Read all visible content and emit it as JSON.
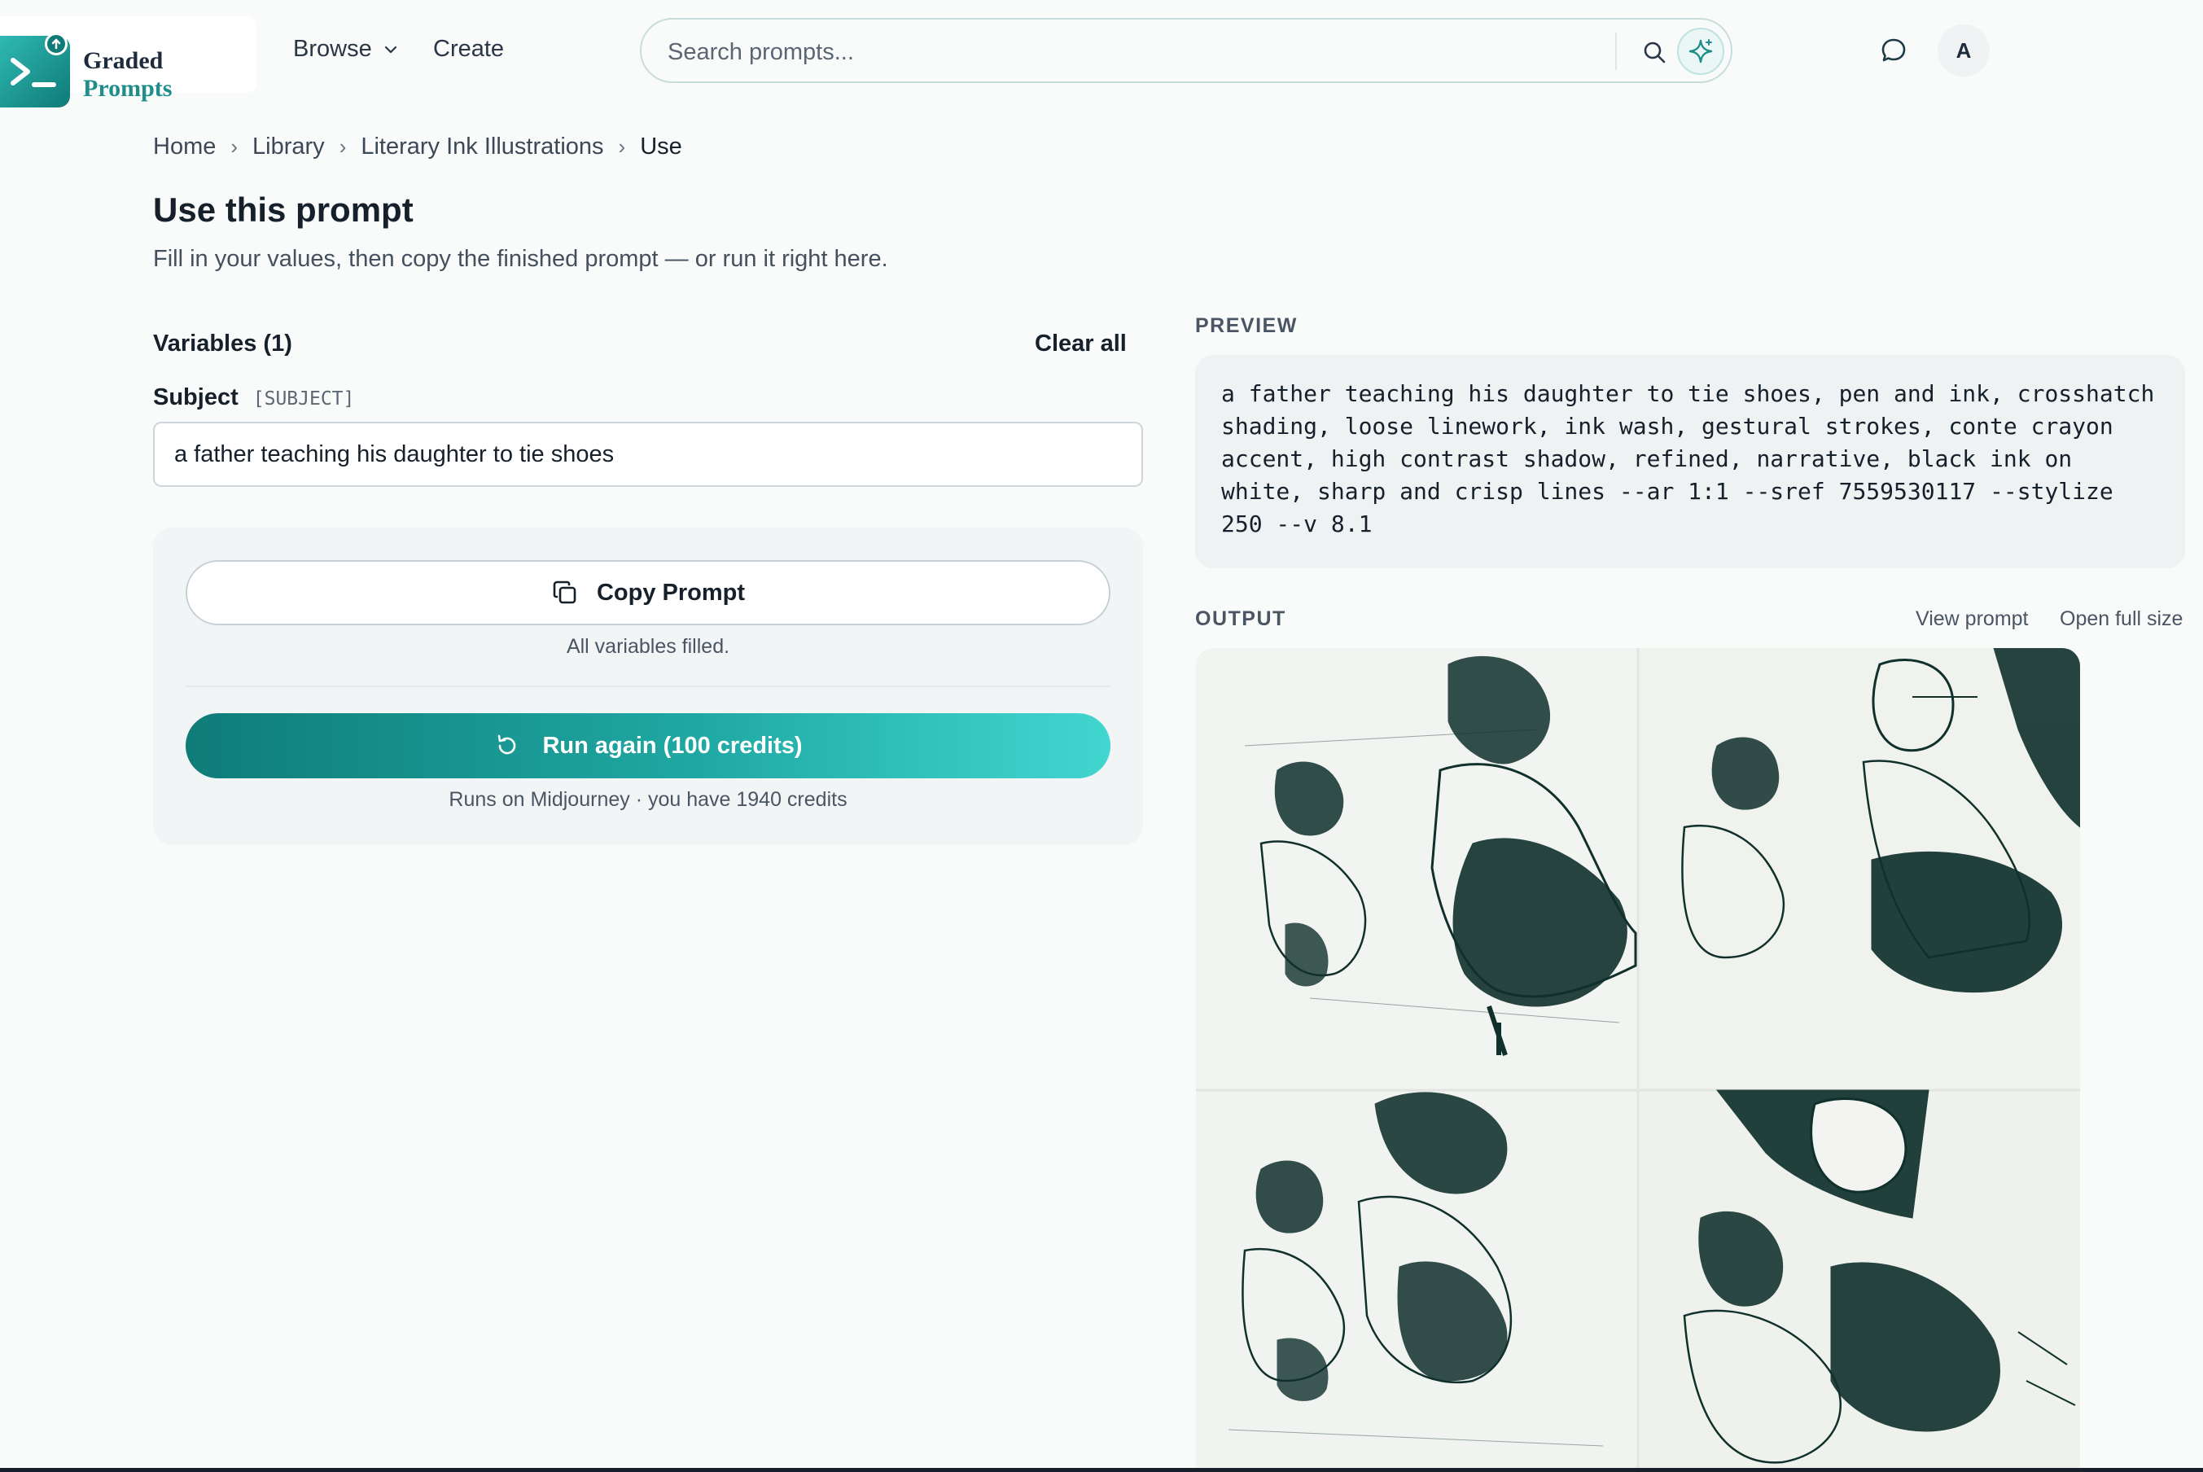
{
  "brand": {
    "line1": "Graded",
    "line2": "Prompts"
  },
  "nav": {
    "browse": "Browse",
    "create": "Create"
  },
  "search": {
    "placeholder": "Search prompts..."
  },
  "user": {
    "avatar_initial": "A"
  },
  "breadcrumb": {
    "home": "Home",
    "library": "Library",
    "collection": "Literary Ink Illustrations",
    "current": "Use"
  },
  "page": {
    "title": "Use this prompt",
    "subtitle": "Fill in your values, then copy the finished prompt — or run it right here."
  },
  "variables": {
    "heading": "Variables (1)",
    "clear_all": "Clear all",
    "fields": [
      {
        "label": "Subject",
        "key": "[SUBJECT]",
        "value": "a father teaching his daughter to tie shoes"
      }
    ]
  },
  "actions": {
    "copy_label": "Copy Prompt",
    "filled_note": "All variables filled.",
    "run_label": "Run again (100 credits)",
    "runs_note": "Runs on Midjourney · you have 1940 credits"
  },
  "preview": {
    "label": "PREVIEW",
    "text": "a father teaching his daughter to tie shoes, pen and ink, crosshatch shading, loose linework, ink wash, gestural strokes, conte crayon accent, high contrast shadow, refined, narrative, black ink on white, sharp and crisp lines --ar 1:1 --sref 7559530117 --stylize 250 --v 8.1"
  },
  "output": {
    "label": "OUTPUT",
    "view_prompt": "View prompt",
    "open_full_size": "Open full size"
  },
  "colors": {
    "accent": "#1f8d89",
    "ink": "#10302c",
    "background": "#f9fafa"
  }
}
